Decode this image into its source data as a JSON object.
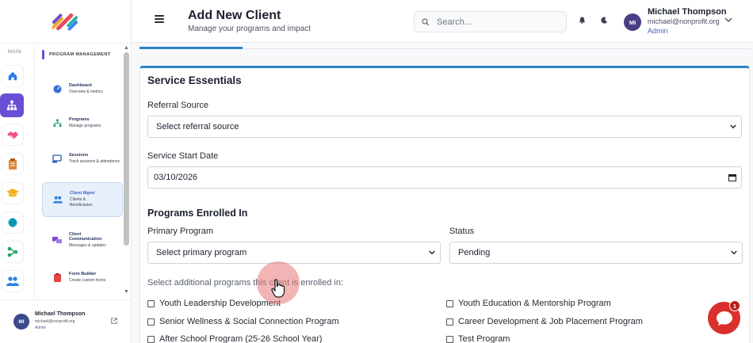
{
  "header": {
    "title": "Add New Client",
    "subtitle": "Manage your programs and impact",
    "search_placeholder": "Search...",
    "user_initials": "MI",
    "user_name": "Michael Thompson",
    "user_email": "michael@nonprofit.org",
    "user_role": "Admin"
  },
  "sidebar": {
    "rail_label": "MAIN",
    "panel_title": "PROGRAM MANAGEMENT",
    "items": [
      {
        "title": "Dashboard",
        "sub": "Overview & metrics"
      },
      {
        "title": "Programs",
        "sub": "Manage programs"
      },
      {
        "title": "Sessions",
        "sub": "Track sessions & attendance"
      },
      {
        "title": "Client Mgmt",
        "sub": "Clients & Beneficiaries"
      },
      {
        "title": "Client Communication",
        "sub": "Messages & updates"
      },
      {
        "title": "Form Builder",
        "sub": "Create custom forms"
      }
    ],
    "footer": {
      "initials": "MI",
      "name": "Michael Thompson",
      "email": "michael@nonprofit.org",
      "role": "Admin"
    }
  },
  "form": {
    "section_title": "Service Essentials",
    "referral_label": "Referral Source",
    "referral_value": "Select referral source",
    "start_date_label": "Service Start Date",
    "start_date_value": "03/10/2026",
    "programs_title": "Programs Enrolled In",
    "primary_label": "Primary Program",
    "primary_value": "Select primary program",
    "status_label": "Status",
    "status_value": "Pending",
    "additional_hint": "Select additional programs this client is enrolled in:",
    "programs": [
      "Youth Leadership Development",
      "Youth Education & Mentorship Program",
      "Senior Wellness & Social Connection Program",
      "Career Development & Job Placement Program",
      "After School Program (25-26 School Year)",
      "Test Program"
    ]
  },
  "chat": {
    "badge_count": "1"
  },
  "colors": {
    "accent": "#2b84c7",
    "brand_purple": "#6a4fd6",
    "chat_red": "#d9302c"
  }
}
